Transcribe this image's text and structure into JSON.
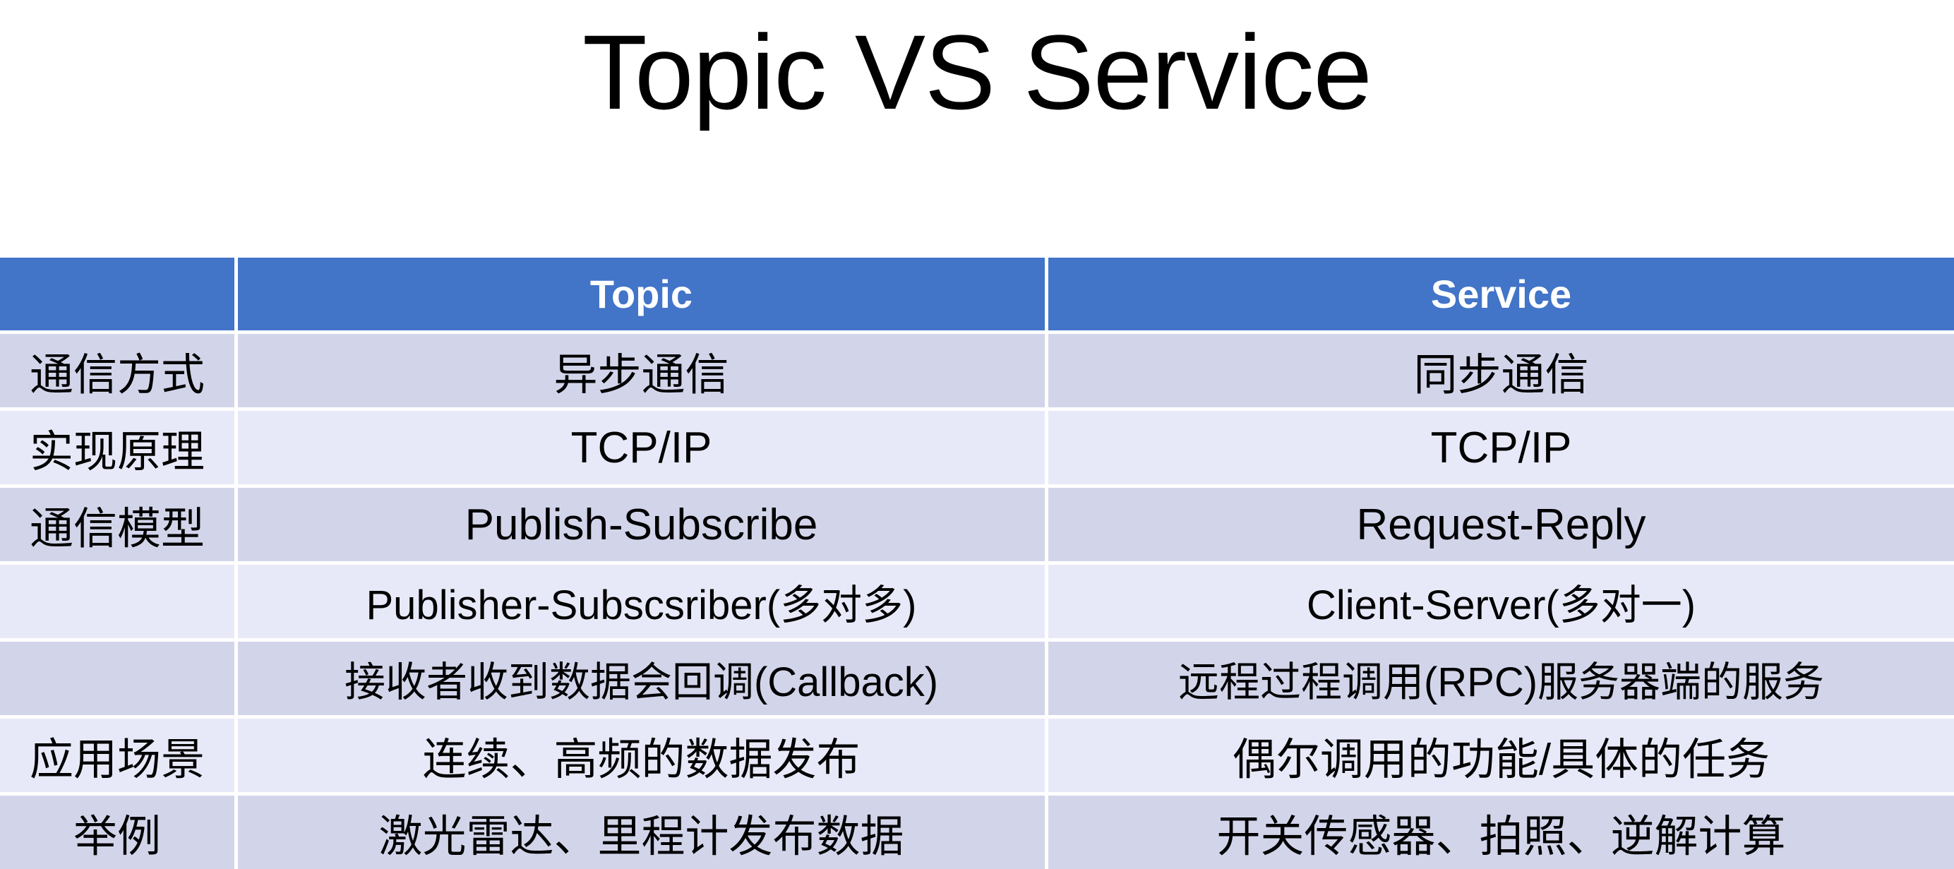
{
  "slide": {
    "title": "Topic VS Service",
    "background_color": "#FFFFFF"
  },
  "theme": {
    "header_bg": "#4274C8",
    "header_text": "#FFFFFF",
    "row_dark_bg": "#D2D5EA",
    "row_light_bg": "#E8E9F8",
    "body_text": "#000000",
    "gridline": "#FFFFFF"
  },
  "table": {
    "headers": {
      "label": "",
      "topic": "Topic",
      "service": "Service"
    },
    "rows": [
      {
        "label": "通信方式",
        "topic": "异步通信",
        "service": "同步通信",
        "shade": "dark"
      },
      {
        "label": "实现原理",
        "topic": "TCP/IP",
        "service": "TCP/IP",
        "shade": "light"
      },
      {
        "label": "通信模型",
        "topic": "Publish-Subscribe",
        "service": "Request-Reply",
        "shade": "dark"
      },
      {
        "label": "",
        "topic": "Publisher-Subscsriber(多对多)",
        "service": "Client-Server(多对一)",
        "shade": "light"
      },
      {
        "label": "",
        "topic": "接收者收到数据会回调(Callback)",
        "service": "远程过程调用(RPC)服务器端的服务",
        "shade": "dark"
      },
      {
        "label": "应用场景",
        "topic": "连续、高频的数据发布",
        "service": "偶尔调用的功能/具体的任务",
        "shade": "light"
      },
      {
        "label": "举例",
        "topic": "激光雷达、里程计发布数据",
        "service": "开关传感器、拍照、逆解计算",
        "shade": "dark"
      }
    ]
  }
}
